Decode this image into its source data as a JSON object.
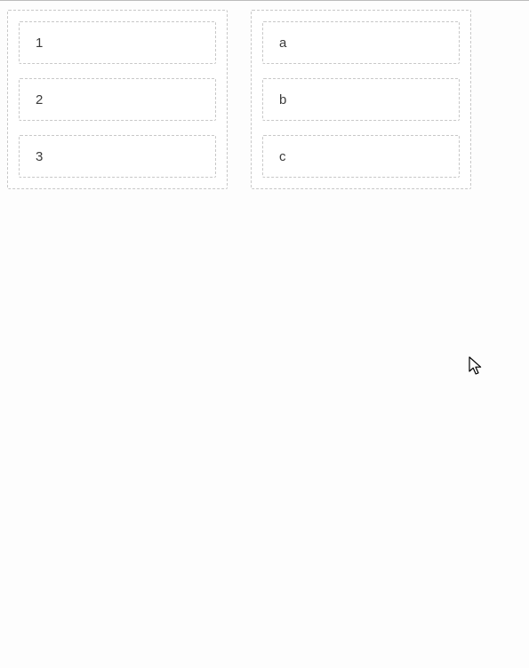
{
  "left_list": {
    "items": [
      {
        "label": "1"
      },
      {
        "label": "2"
      },
      {
        "label": "3"
      }
    ]
  },
  "right_list": {
    "items": [
      {
        "label": "a"
      },
      {
        "label": "b"
      },
      {
        "label": "c"
      }
    ]
  }
}
